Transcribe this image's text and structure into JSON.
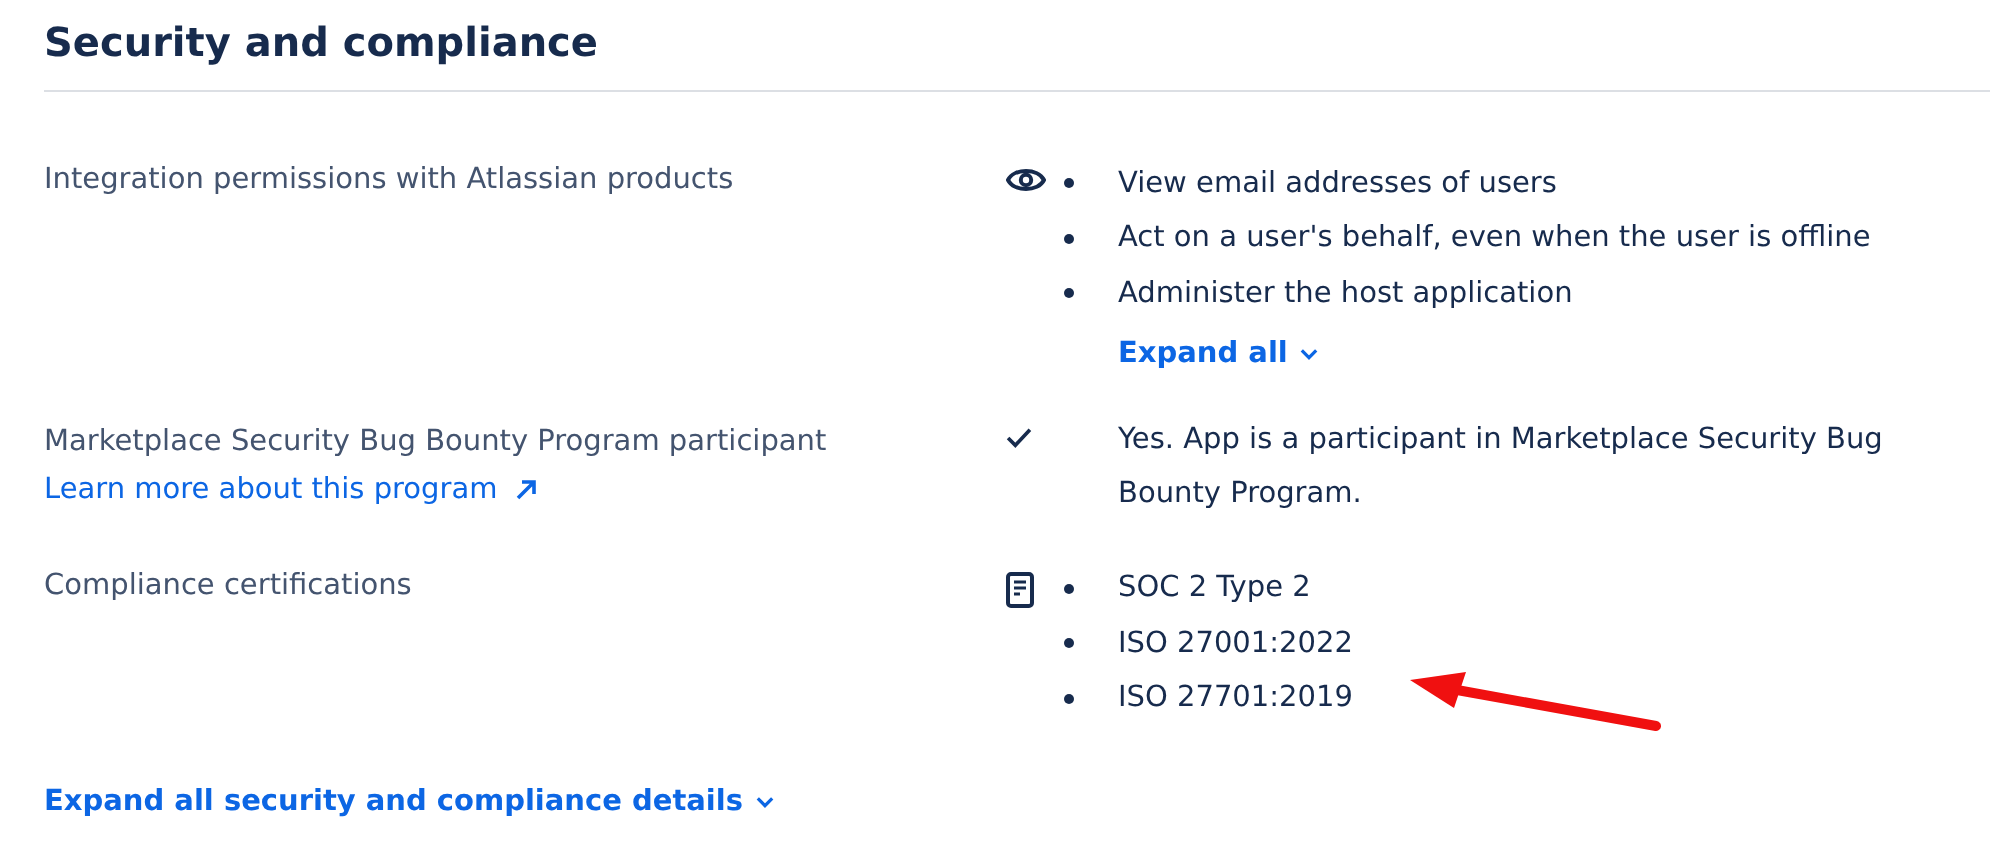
{
  "section": {
    "title": "Security and compliance"
  },
  "rows": [
    {
      "label": "Integration permissions with Atlassian products",
      "kind": "list",
      "items": [
        "View email addresses of users",
        "Act on a user's behalf, even when the user is offline",
        "Administer the host application"
      ],
      "expand_link": "Expand all"
    },
    {
      "label": "Marketplace Security Bug Bounty Program participant",
      "link": "Learn more about this program",
      "kind": "text",
      "text": "Yes. App is a participant in Marketplace Security Bug Bounty Program."
    },
    {
      "label": "Compliance certifications",
      "kind": "list",
      "items": [
        "SOC 2 Type 2",
        "ISO 27001:2022",
        "ISO 27701:2019"
      ]
    }
  ],
  "footer_link": "Expand all security and compliance details"
}
